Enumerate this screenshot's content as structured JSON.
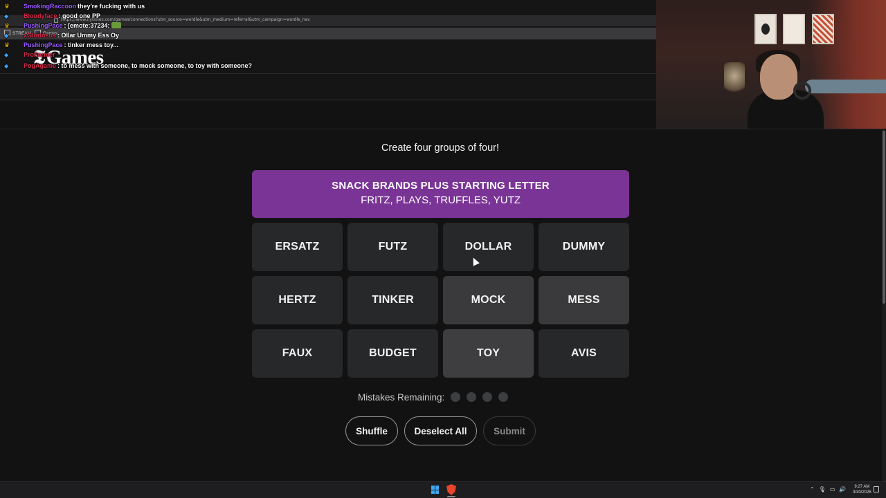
{
  "browser": {
    "url": "https://www.nytimes.com/games/connections?utm_source=wordle&utm_medium=referral&utm_campaign=wordle_nav",
    "tabs": [
      "STREAM",
      "Games"
    ]
  },
  "site": {
    "logo_mark": "𝕿",
    "logo_text": "Games"
  },
  "chat": [
    {
      "user": "SmokingRaccoon",
      "message": "they're fucking with us",
      "user_color": "#9b59ff",
      "badge": "crown"
    },
    {
      "user": "Bloodyface",
      "message": "good one PP",
      "user_color": "#d8284a",
      "badge": "gem"
    },
    {
      "user": "PushingPace",
      "message": "[emote:37234:",
      "user_color": "#9b59ff",
      "badge": "crown"
    },
    {
      "user": "xGloriosus",
      "message": "Ollar Ummy Ess Oy",
      "user_color": "#d8284a",
      "badge": "gem"
    },
    {
      "user": "PushingPace",
      "message": "tinker mess toy...",
      "user_color": "#9b59ff",
      "badge": "crown"
    },
    {
      "user": "ProFarmer",
      "message": "",
      "user_color": "#d8284a",
      "badge": "gem"
    },
    {
      "user": "PogAgame",
      "message": "to mess with someone, to mock someone, to toy with someone?",
      "user_color": "#d8284a",
      "badge": "gem"
    }
  ],
  "game": {
    "instructions": "Create four groups of four!",
    "solved_groups": [
      {
        "title": "SNACK BRANDS PLUS STARTING LETTER",
        "members": "FRITZ, PLAYS, TRUFFLES, YUTZ",
        "color": "#7a3496"
      }
    ],
    "tiles": [
      {
        "word": "ERSATZ",
        "selected": false
      },
      {
        "word": "FUTZ",
        "selected": false
      },
      {
        "word": "DOLLAR",
        "selected": false
      },
      {
        "word": "DUMMY",
        "selected": false
      },
      {
        "word": "HERTZ",
        "selected": false
      },
      {
        "word": "TINKER",
        "selected": false
      },
      {
        "word": "MOCK",
        "selected": false
      },
      {
        "word": "MESS",
        "selected": false
      },
      {
        "word": "FAUX",
        "selected": false
      },
      {
        "word": "BUDGET",
        "selected": false
      },
      {
        "word": "TOY",
        "selected": false
      },
      {
        "word": "AVIS",
        "selected": false
      }
    ],
    "mistakes_label": "Mistakes Remaining:",
    "mistakes_remaining": 4,
    "buttons": {
      "shuffle": "Shuffle",
      "deselect": "Deselect All",
      "submit": "Submit"
    }
  },
  "taskbar": {
    "time": "9:27 AM",
    "date": "3/30/2026"
  }
}
